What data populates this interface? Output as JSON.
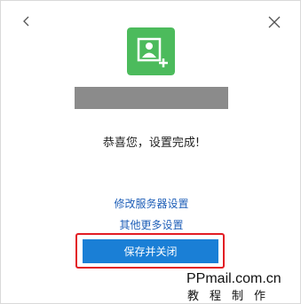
{
  "dialog": {
    "status_text": "恭喜您，设置完成!",
    "links": {
      "modify_server": "修改服务器设置",
      "more_settings": "其他更多设置"
    },
    "save_button_label": "保存并关闭"
  },
  "watermark": {
    "domain": "PPmail.com.cn",
    "subtitle": "教程制作"
  },
  "colors": {
    "logo_green": "#4cbb5c",
    "link_blue": "#1f5fb8",
    "button_blue": "#1a7fd6",
    "highlight_red": "#e21c24"
  },
  "icons": {
    "back": "chevron-left-icon",
    "close": "close-icon",
    "logo": "add-contact-icon"
  }
}
